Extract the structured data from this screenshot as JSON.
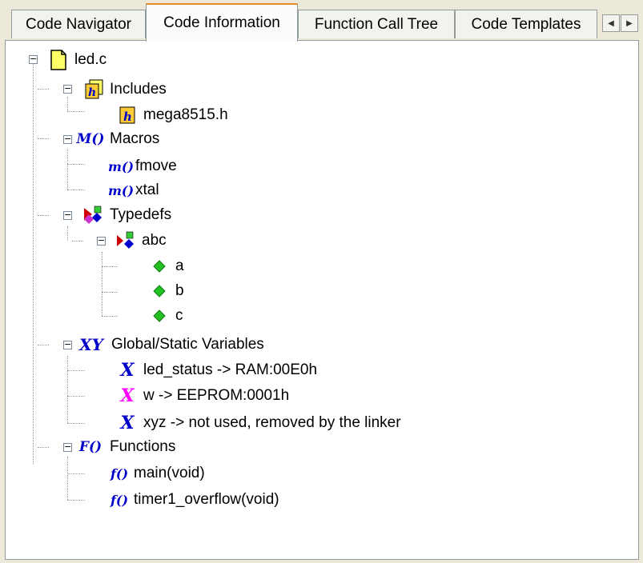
{
  "tabs": [
    {
      "label": "Code Navigator"
    },
    {
      "label": "Code Information"
    },
    {
      "label": "Function Call Tree"
    },
    {
      "label": "Code Templates"
    }
  ],
  "tree": {
    "file": "led.c",
    "includes": {
      "label": "Includes",
      "items": [
        "mega8515.h"
      ]
    },
    "macros": {
      "label": "Macros",
      "icon_text": "M()",
      "items": [
        "fmove",
        "xtal"
      ],
      "item_icon_text": "m()"
    },
    "typedefs": {
      "label": "Typedefs",
      "items": [
        {
          "label": "abc",
          "members": [
            "a",
            "b",
            "c"
          ]
        }
      ]
    },
    "globals": {
      "label": "Global/Static Variables",
      "icon_text": "XY",
      "item_icon_text": "X",
      "items": [
        "led_status -> RAM:00E0h",
        "w -> EEPROM:0001h",
        "xyz -> not used, removed by the linker"
      ]
    },
    "functions": {
      "label": "Functions",
      "icon_text": "F()",
      "item_icon_text": "f()",
      "items": [
        "main(void)",
        "timer1_overflow(void)"
      ]
    }
  },
  "colors": {
    "active_tab_accent": "#e68b2c",
    "var_ram": "#0000cc",
    "var_eeprom": "#ff00ff",
    "member_green": "#22c022"
  }
}
